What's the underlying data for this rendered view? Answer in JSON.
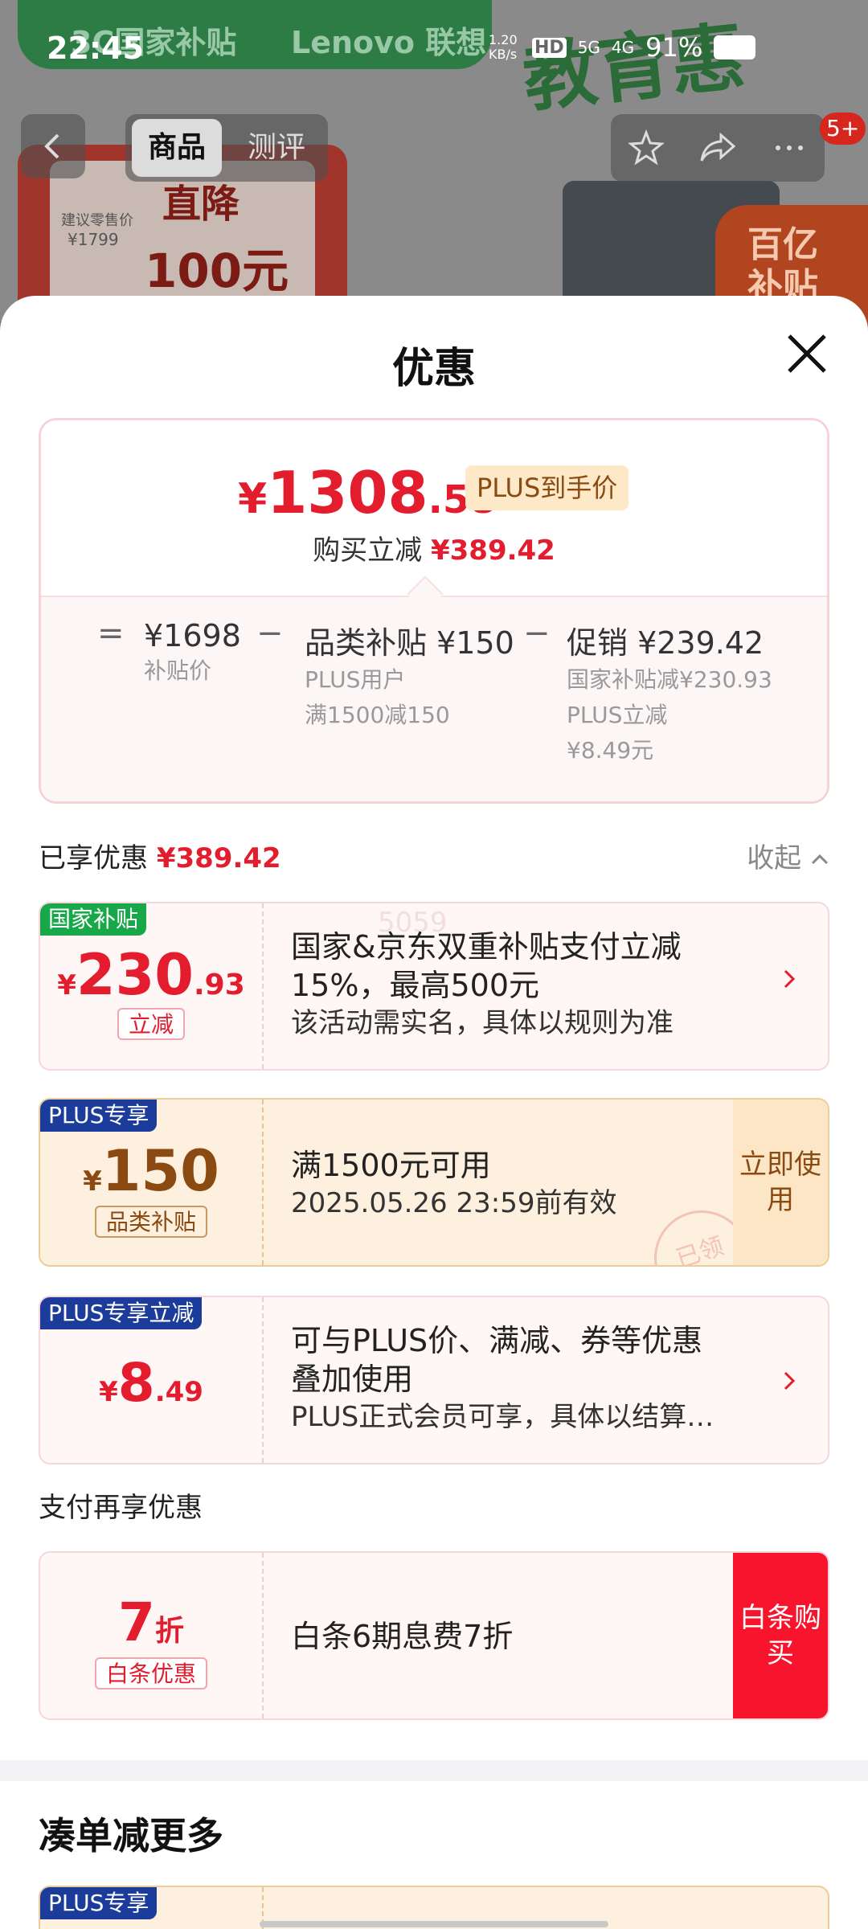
{
  "status_bar": {
    "time": "22:45",
    "net_speed": "1.20 KB/s",
    "hd": "HD",
    "signal1": "5G",
    "signal2": "4G",
    "battery": "91%"
  },
  "background": {
    "banner_left": "3C国家补贴",
    "banner_right": "Lenovo 联想",
    "calligraphy": "教育惠",
    "promo_line1": "建议零售价",
    "promo_price": "¥1799",
    "promo_big1": "直降",
    "promo_big2": "100元",
    "corner_text": "百亿补贴"
  },
  "nav": {
    "tab_active": "商品",
    "tab_other": "测评",
    "badge": "5+"
  },
  "sheet": {
    "title": "优惠",
    "summary": {
      "currency": "¥",
      "price_int": "1308",
      "price_dec": ".58",
      "plus_tag": "PLUS到手价",
      "reduce_label": "购买立减",
      "reduce_amount": "¥389.42",
      "op_eq": "=",
      "op_minus": "−",
      "base_value": "¥1698",
      "base_label": "补贴价",
      "cat_value": "品类补贴 ¥150",
      "cat_sub1": "PLUS用户",
      "cat_sub2": "满1500减150",
      "promo_value": "促销 ¥239.42",
      "promo_sub1": "国家补贴减¥230.93",
      "promo_sub2": "PLUS立减",
      "promo_sub3": "¥8.49元"
    },
    "enjoyed": {
      "label": "已享优惠",
      "amount": "¥389.42",
      "collapse": "收起"
    },
    "cards": [
      {
        "tag": "国家补贴",
        "currency": "¥",
        "amount_int": "230",
        "amount_dec": ".93",
        "chip": "立减",
        "line1": "国家&京东双重补贴支付立减",
        "line2": "15%，最高500元",
        "line3": "该活动需实名，具体以规则为准",
        "watermark": "5059"
      },
      {
        "tag": "PLUS专享",
        "currency": "¥",
        "amount_int": "150",
        "chip": "品类补贴",
        "line1": "满1500元可用",
        "line2": "2025.05.26 23:59前有效",
        "button": "立即使用",
        "stamp": "已领"
      },
      {
        "tag": "PLUS专享立减",
        "currency": "¥",
        "amount_int": "8",
        "amount_dec": ".49",
        "line1": "可与PLUS价、满减、券等优惠",
        "line2": "叠加使用",
        "line3": "PLUS正式会员可享，具体以结算…"
      }
    ],
    "pay": {
      "header": "支付再享优惠",
      "amount": "7",
      "unit": "折",
      "chip": "白条优惠",
      "desc": "白条6期息费7折",
      "button": "白条购买"
    },
    "more": {
      "title": "凑单减更多",
      "tag": "PLUS专享"
    }
  },
  "colors": {
    "red": "#e31d2d",
    "green_tag": "#18a84a",
    "plus_blue": "#1b3c9a",
    "gold_text": "#8a4a12",
    "button_red": "#f8142c"
  }
}
